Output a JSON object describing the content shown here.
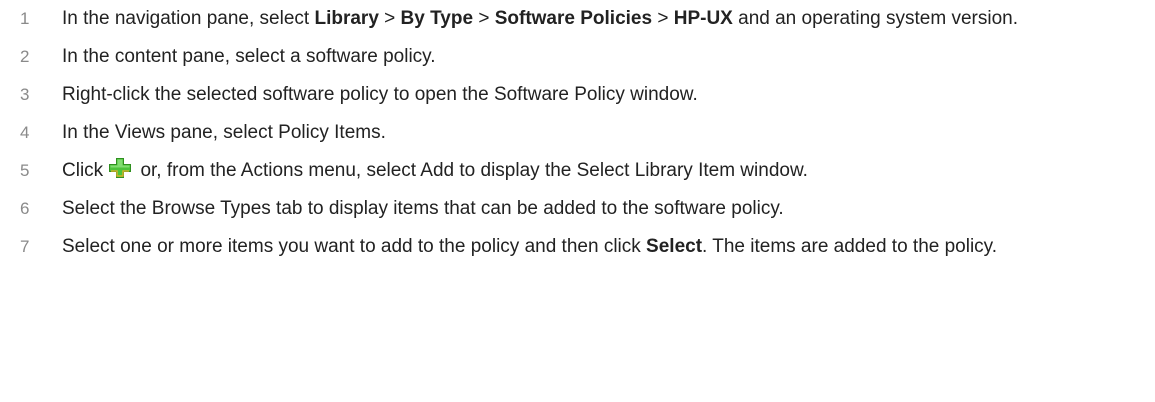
{
  "steps": [
    {
      "num": "1",
      "parts": {
        "a": "In the navigation pane, select ",
        "b1": "Library",
        "c": " > ",
        "b2": "By Type",
        "d": " > ",
        "b3": "Software Policies",
        "e": " > ",
        "b4": "HP-UX",
        "f": " and an operating system version."
      }
    },
    {
      "num": "2",
      "text": "In the content pane, select a software policy."
    },
    {
      "num": "3",
      "text": "Right-click the selected software policy to open the Software Policy window."
    },
    {
      "num": "4",
      "text": "In the Views pane, select Policy Items."
    },
    {
      "num": "5",
      "before": "Click",
      "after": "or, from the Actions menu, select Add to display the Select Library Item window.",
      "icon": "add-plus-icon",
      "icon_color": "#3fae2a"
    },
    {
      "num": "6",
      "text": "Select the Browse Types tab to display items that can be added to the software policy."
    },
    {
      "num": "7",
      "before": "Select one or more items you want to add to the policy and then click ",
      "bold": "Select",
      "after": ". The items are added to the policy."
    }
  ]
}
